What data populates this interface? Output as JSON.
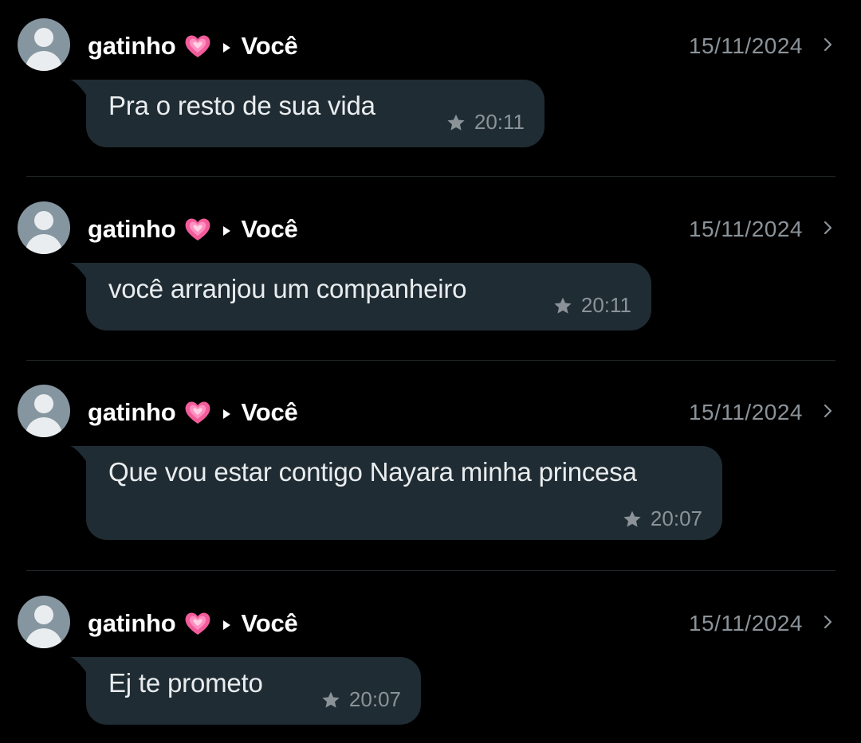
{
  "colors": {
    "background": "#000000",
    "bubble": "#202c33",
    "message_text": "#e9edef",
    "meta_text": "#8b9399",
    "avatar": "#8696a0"
  },
  "messages": [
    {
      "sender": "gatinho",
      "sender_emoji": "growing-heart-icon",
      "recipient": "Você",
      "date": "15/11/2024",
      "text": "Pra o resto de sua vida",
      "time": "20:11",
      "starred": true
    },
    {
      "sender": "gatinho",
      "sender_emoji": "growing-heart-icon",
      "recipient": "Você",
      "date": "15/11/2024",
      "text": "você arranjou um companheiro",
      "time": "20:11",
      "starred": true
    },
    {
      "sender": "gatinho",
      "sender_emoji": "growing-heart-icon",
      "recipient": "Você",
      "date": "15/11/2024",
      "text": "Que vou estar contigo Nayara minha princesa",
      "time": "20:07",
      "starred": true
    },
    {
      "sender": "gatinho",
      "sender_emoji": "growing-heart-icon",
      "recipient": "Você",
      "date": "15/11/2024",
      "text": "Ej te prometo",
      "time": "20:07",
      "starred": true
    }
  ]
}
